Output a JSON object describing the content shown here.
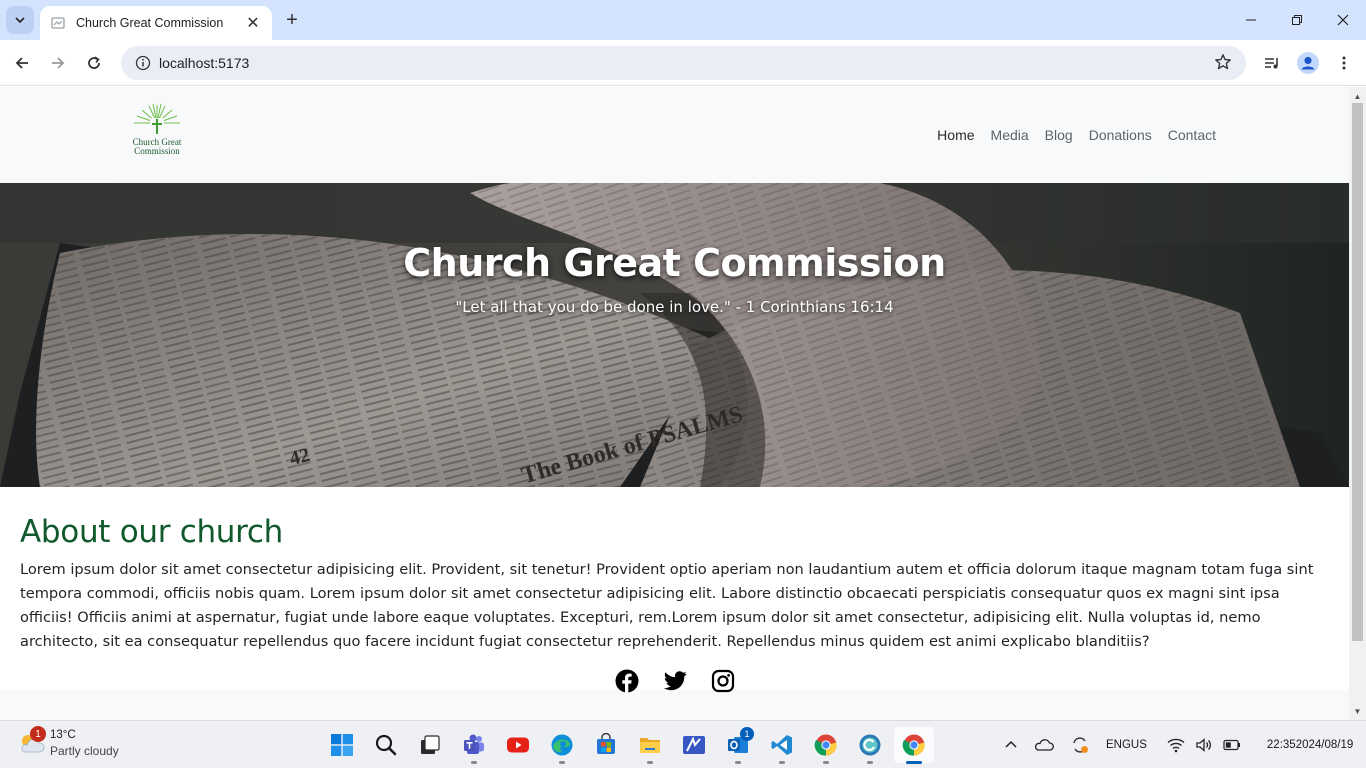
{
  "browser": {
    "tab_title": "Church Great Commission",
    "url": "localhost:5173"
  },
  "site": {
    "logo_text_line1": "Church Great",
    "logo_text_line2": "Commission",
    "nav": [
      "Home",
      "Media",
      "Blog",
      "Donations",
      "Contact"
    ],
    "active_nav": "Home",
    "hero_title": "Church Great Commission",
    "hero_quote": "\"Let all that you do be done in love.\" - 1 Corinthians 16:14",
    "about_heading": "About our church",
    "about_text": "Lorem ipsum dolor sit amet consectetur adipisicing elit. Provident, sit tenetur! Provident optio aperiam non laudantium autem et officia dolorum itaque magnam totam fuga sint tempora commodi, officiis nobis quam. Lorem ipsum dolor sit amet consectetur adipisicing elit. Labore distinctio obcaecati perspiciatis consequatur quos ex magni sint ipsa officiis! Officiis animi at aspernatur, fugiat unde labore eaque voluptates. Excepturi, rem.Lorem ipsum dolor sit amet consectetur, adipisicing elit. Nulla voluptas id, nemo architecto, sit ea consequatur repellendus quo facere incidunt fugiat consectetur reprehenderit. Repellendus minus quidem est animi explicabo blanditiis?",
    "social_icons": [
      "facebook-icon",
      "twitter-icon",
      "instagram-icon"
    ],
    "hero_book_text": "The Book of PSALMS",
    "hero_page_number": "42"
  },
  "taskbar": {
    "weather_temp": "13°C",
    "weather_condition": "Partly cloudy",
    "weather_badge": "1",
    "outlook_badge": "1",
    "lang_line1": "ENG",
    "lang_line2": "US",
    "time": "22:35",
    "date": "2024/08/19"
  },
  "colors": {
    "accent_green": "#10592c",
    "tabstrip": "#d3e3fd",
    "taskbar": "#eef0f4"
  }
}
